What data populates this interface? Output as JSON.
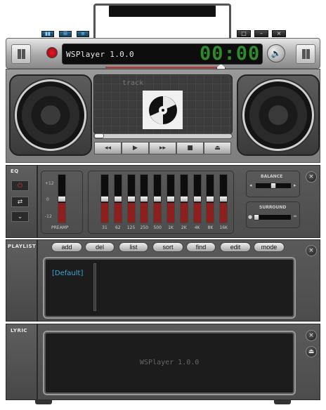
{
  "titlebar": {
    "view_buttons": [
      "spectrum-icon",
      "list-icon",
      "menu-icon"
    ],
    "window_buttons": [
      {
        "name": "restore-button",
        "glyph": "□"
      },
      {
        "name": "minimize-button",
        "glyph": "–"
      },
      {
        "name": "close-button",
        "glyph": "×"
      }
    ]
  },
  "display": {
    "title": "WSPlayer 1.0.0",
    "time": "00:00"
  },
  "screen": {
    "track_label": "track"
  },
  "transport": [
    {
      "name": "rewind-button",
      "glyph": "◂◂"
    },
    {
      "name": "play-button",
      "glyph": "▶"
    },
    {
      "name": "fast-forward-button",
      "glyph": "▸▸"
    },
    {
      "name": "stop-button",
      "glyph": "■"
    },
    {
      "name": "eject-button",
      "glyph": "⏏"
    }
  ],
  "eq": {
    "label": "EQ",
    "db_labels": [
      "+12",
      "0",
      "-12"
    ],
    "preamp_label": "PREAMP",
    "preamp_level": 0.5,
    "bands": [
      {
        "freq": "31",
        "level": 0.5
      },
      {
        "freq": "62",
        "level": 0.5
      },
      {
        "freq": "125",
        "level": 0.5
      },
      {
        "freq": "250",
        "level": 0.5
      },
      {
        "freq": "500",
        "level": 0.5
      },
      {
        "freq": "1K",
        "level": 0.5
      },
      {
        "freq": "2K",
        "level": 0.5
      },
      {
        "freq": "4K",
        "level": 0.5
      },
      {
        "freq": "8K",
        "level": 0.5
      },
      {
        "freq": "16K",
        "level": 0.5
      }
    ],
    "balance_label": "BALANCE",
    "balance_value": 0.5,
    "surround_label": "SURROUND",
    "surround_value": 0.0
  },
  "playlist": {
    "label": "PLAYLIST",
    "buttons": [
      "add",
      "del",
      "list",
      "sort",
      "find",
      "edit",
      "mode"
    ],
    "items": [
      "[Default]"
    ]
  },
  "lyric": {
    "label": "LYRIC",
    "text": "WSPlayer 1.0.0"
  }
}
